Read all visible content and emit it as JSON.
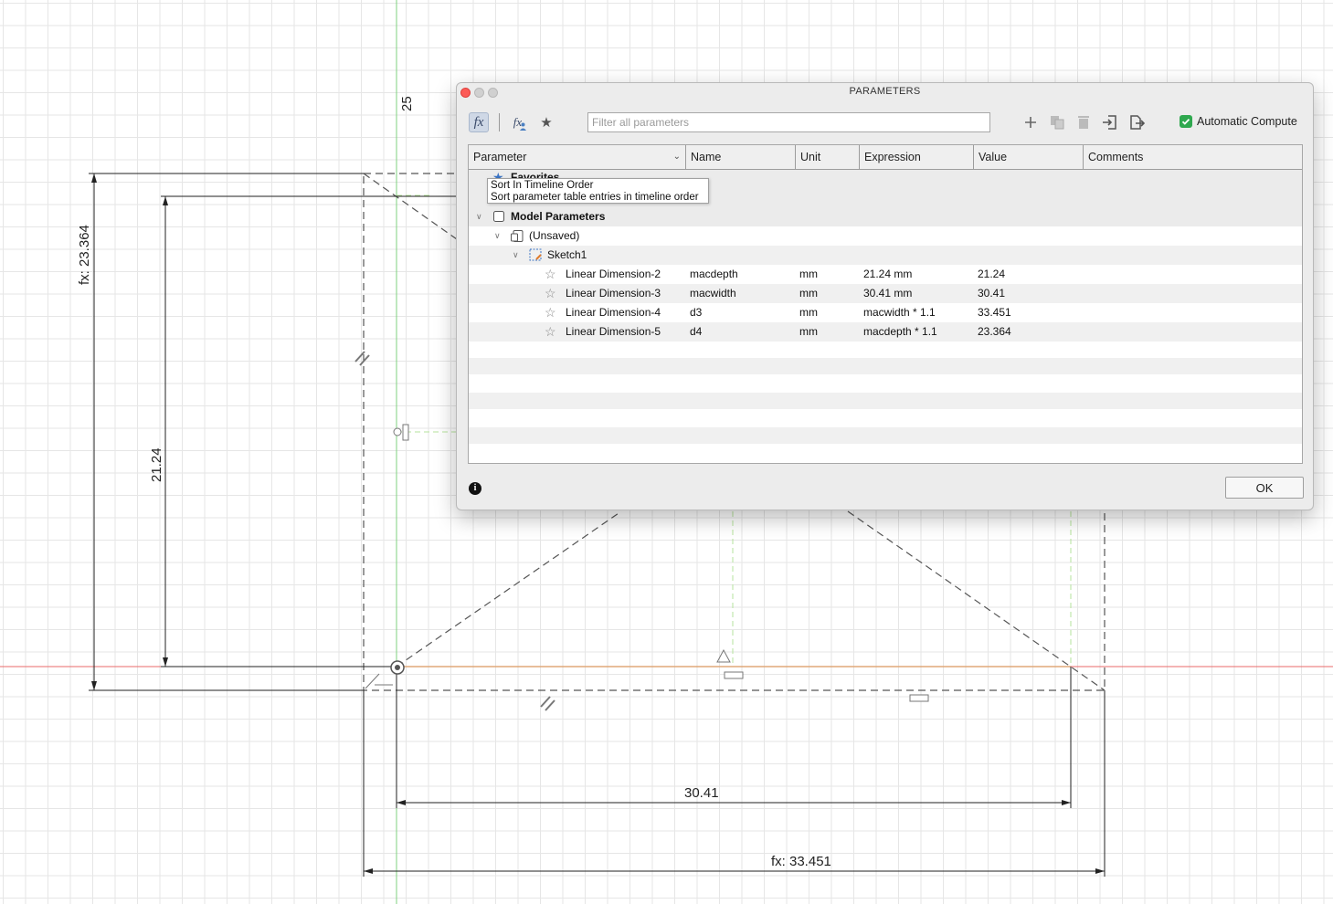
{
  "dialog": {
    "title": "PARAMETERS",
    "filter_placeholder": "Filter all parameters",
    "auto_compute_label": "Automatic Compute",
    "ok_label": "OK",
    "info_glyph": "i",
    "toolbar_icons": [
      "fx-icon",
      "fx-user-icon",
      "star-icon",
      "plus-icon",
      "copy-icon",
      "trash-icon",
      "import-icon",
      "export-icon"
    ]
  },
  "table": {
    "columns": [
      "Parameter",
      "Name",
      "Unit",
      "Expression",
      "Value",
      "Comments"
    ],
    "favorites_label": "Favorites",
    "model_parameters_label": "Model Parameters",
    "component_label": "(Unsaved)",
    "sketch_label": "Sketch1",
    "rows": [
      {
        "parameter": "Linear Dimension-2",
        "name": "macdepth",
        "unit": "mm",
        "expression": "21.24 mm",
        "value": "21.24",
        "comments": ""
      },
      {
        "parameter": "Linear Dimension-3",
        "name": "macwidth",
        "unit": "mm",
        "expression": "30.41 mm",
        "value": "30.41",
        "comments": ""
      },
      {
        "parameter": "Linear Dimension-4",
        "name": "d3",
        "unit": "mm",
        "expression": "macwidth * 1.1",
        "value": "33.451",
        "comments": ""
      },
      {
        "parameter": "Linear Dimension-5",
        "name": "d4",
        "unit": "mm",
        "expression": "macdepth * 1.1",
        "value": "23.364",
        "comments": ""
      }
    ]
  },
  "tooltip": {
    "title": "Sort In Timeline Order",
    "description": "Sort parameter table entries in timeline order"
  },
  "sketch": {
    "dim_outer_height": "fx: 23.364",
    "dim_inner_height": "21.24",
    "dim_inner_width": "30.41",
    "dim_outer_width": "fx: 33.451",
    "axis_label_25": "25"
  },
  "colors": {
    "x_axis": "#e86a6a",
    "y_axis": "#7fd07f",
    "construction_line": "#9be07f",
    "accent_check": "#2fa84f"
  }
}
